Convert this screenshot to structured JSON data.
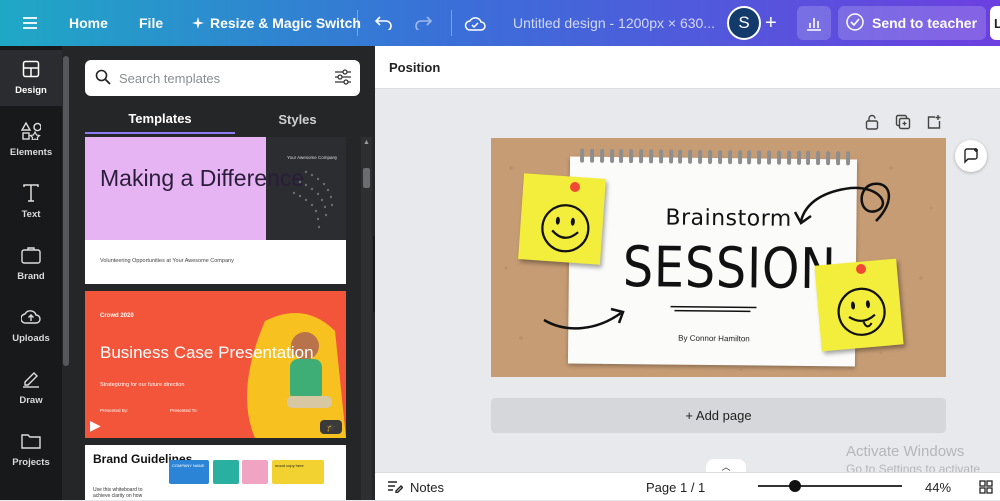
{
  "topbar": {
    "home": "Home",
    "file": "File",
    "resize": "Resize & Magic Switch",
    "title": "Untitled design - 1200px × 630...",
    "avatar": "S",
    "send": "Send to teacher",
    "user_initial": "L"
  },
  "rail": {
    "items": [
      {
        "label": "Design",
        "icon": "design-icon"
      },
      {
        "label": "Elements",
        "icon": "elements-icon"
      },
      {
        "label": "Text",
        "icon": "text-icon"
      },
      {
        "label": "Brand",
        "icon": "brand-icon"
      },
      {
        "label": "Uploads",
        "icon": "uploads-icon"
      },
      {
        "label": "Draw",
        "icon": "draw-icon"
      },
      {
        "label": "Projects",
        "icon": "projects-icon"
      }
    ]
  },
  "panel": {
    "search_placeholder": "Search templates",
    "tabs": [
      "Templates",
      "Styles"
    ],
    "templates": [
      {
        "title": "Making a Difference",
        "subtitle": "Volunteering Opportunities at Your Awesome Company",
        "company": "Your Awesome Company"
      },
      {
        "tag": "Crowd 2020",
        "title": "Business Case Presentation",
        "subtitle": "Strategizing for our future direction",
        "presented_by": "Presented By:",
        "presented_to": "Presented To:"
      },
      {
        "title": "Brand Guidelines",
        "subtitle": "Use this whiteboard to achieve clarity on how",
        "tile1": "COMPANY NAME",
        "tile2": "mood copy here"
      }
    ]
  },
  "toolbar": {
    "position": "Position"
  },
  "canvas": {
    "brainstorm": "Brainstorm",
    "session": "SESSION",
    "byline": "By Connor Hamilton"
  },
  "add_page": "+ Add page",
  "watermark": {
    "line1": "Activate Windows",
    "line2": "Go to Settings to activate Windows."
  },
  "bottombar": {
    "notes": "Notes",
    "page": "Page 1 / 1",
    "zoom": "44%"
  }
}
